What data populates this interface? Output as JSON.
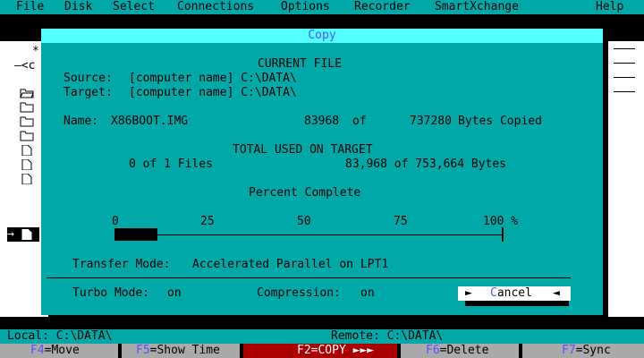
{
  "menu": [
    "File",
    "Disk",
    "Select",
    "Connections",
    "Options",
    "Recorder",
    "SmartXchange",
    "Help"
  ],
  "left_panel": {
    "line1": "*",
    "line2": "—<c",
    "arrow": "→"
  },
  "dialog": {
    "title": "Copy",
    "current_file_heading": "CURRENT FILE",
    "source_label": "Source:",
    "source_value": "[computer name] C:\\DATA\\",
    "target_label": "Target:",
    "target_value": "[computer name] C:\\DATA\\",
    "name_label": "Name:",
    "file_name": "X86BOOT.IMG",
    "bytes_copied": "83968",
    "of_word": "of",
    "file_total_bytes": "737280",
    "bytes_copied_suffix": "Bytes Copied",
    "total_heading": "TOTAL USED ON TARGET",
    "files_summary": "0 of 1 Files",
    "bytes_summary": "83,968 of 753,664 Bytes",
    "percent_heading": "Percent Complete",
    "percent_complete": 11,
    "ticks": [
      "0",
      "25",
      "50",
      "75",
      "100 %"
    ],
    "transfer_mode_label": "Transfer Mode:",
    "transfer_mode_value": "Accelerated Parallel on LPT1",
    "turbo_label": "Turbo Mode:",
    "turbo_value": "on",
    "compression_label": "Compression:",
    "compression_value": "on",
    "cancel_hotkey": "C",
    "cancel_rest": "ancel",
    "arrow_left": "►",
    "arrow_right": "◄"
  },
  "paths": {
    "local": "Local: C:\\DATA\\",
    "remote": "Remote: C:\\DATA\\"
  },
  "fkeys": [
    {
      "key": "F4",
      "label": "=Move"
    },
    {
      "key": "F5",
      "label": "=Show Time"
    },
    {
      "key": "F2",
      "label": "=COPY ►►►"
    },
    {
      "key": "F6",
      "label": "=Delete"
    },
    {
      "key": "F7",
      "label": "=Sync"
    }
  ]
}
